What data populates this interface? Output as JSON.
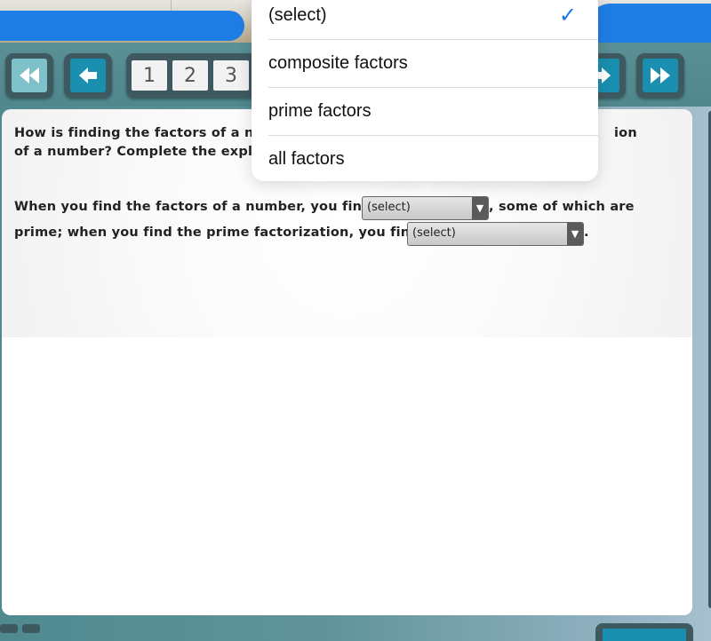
{
  "nav": {
    "first_icon": "double-left-arrow-icon",
    "prev_icon": "left-arrow-icon",
    "next_icon": "right-arrow-icon",
    "last_icon": "double-right-arrow-icon",
    "pages": [
      "1",
      "2",
      "3"
    ]
  },
  "question": {
    "line1_start": "How is finding the factors of a nu",
    "line1_end": "ion",
    "line2_start": "of a number? Complete the expla"
  },
  "sentence": {
    "part1": "When you find the factors of a number, you find",
    "part2": ", some of which are",
    "part3": "prime; when you find the prime factorization, you find",
    "part4": "."
  },
  "selects": [
    {
      "value": "(select)",
      "arrow": "▼"
    },
    {
      "value": "(select)",
      "arrow": "▼"
    }
  ],
  "dropdown": {
    "options": [
      {
        "label": "(select)",
        "selected": true
      },
      {
        "label": "composite factors",
        "selected": false
      },
      {
        "label": "prime factors",
        "selected": false
      },
      {
        "label": "all factors",
        "selected": false
      }
    ],
    "check_icon": "✓",
    "accent_color": "#1a73e8"
  }
}
